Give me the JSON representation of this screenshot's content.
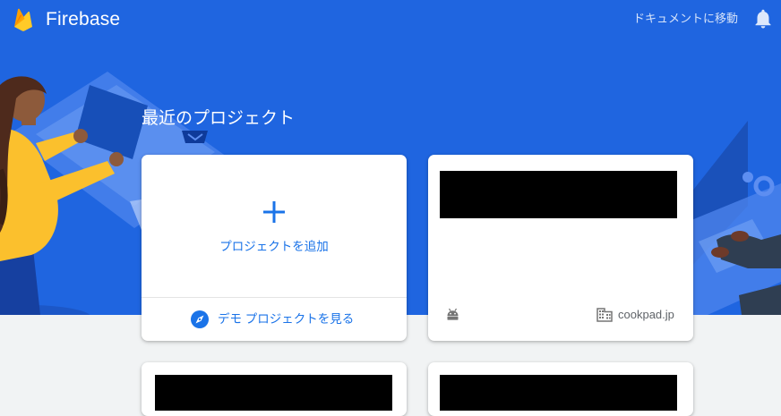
{
  "header": {
    "brand": "Firebase",
    "docs_link": "ドキュメントに移動",
    "icons": {
      "logo": "firebase-flame-icon",
      "notifications": "bell-icon"
    }
  },
  "main": {
    "section_title": "最近のプロジェクト",
    "add_card": {
      "label": "プロジェクトを追加",
      "icon": "plus-icon"
    },
    "demo_link": {
      "label": "デモ プロジェクトを見る",
      "icon": "compass-icon"
    },
    "project_cards": [
      {
        "name": "",
        "redacted": true,
        "platform_icon": "android-icon",
        "org_icon": "building-icon",
        "org_name": "cookpad.jp"
      },
      {
        "name": "",
        "redacted": true
      },
      {
        "name": "",
        "redacted": true
      }
    ]
  },
  "colors": {
    "hero_blue": "#1f65e0",
    "accent_blue": "#1a73e8",
    "page_background": "#f1f3f4",
    "illustration_yellow": "#ffca28"
  }
}
